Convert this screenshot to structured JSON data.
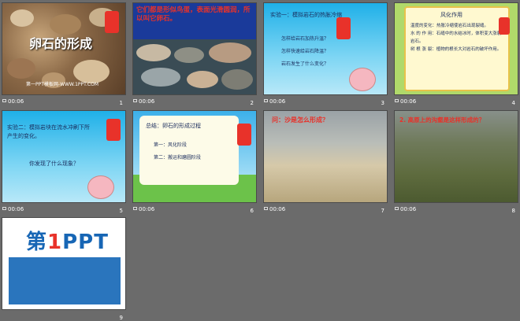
{
  "slides": [
    {
      "num": "1",
      "duration": "00:06",
      "title": "卵石的形成",
      "subtitle": "第一PPT模板网-WWW.1PPT.COM"
    },
    {
      "num": "2",
      "duration": "00:06",
      "caption": "它们都是形似鸟蛋，表面光滑圆润，所以叫它卵石。"
    },
    {
      "num": "3",
      "duration": "00:06",
      "heading": "实验一：模拟岩石的热胀冷缩",
      "items": [
        "怎样给岩石加热升温？",
        "怎样快速给岩石降温？",
        "岩石发生了什么变化？"
      ]
    },
    {
      "num": "4",
      "duration": "00:06",
      "heading": "风化作用",
      "lines": [
        "温度的变化：热胀冷缩使岩石出现裂缝。",
        "水 的 作 用：石缝中的水结冰时，体积变大涨裂岩石。",
        "树 根 涨 裂：植物的根长大对岩石的破坏作用。"
      ]
    },
    {
      "num": "5",
      "duration": "00:06",
      "heading": "实验二：模拟岩块在流水冲刷下所产生的变化。",
      "question": "你发现了什么现象？"
    },
    {
      "num": "6",
      "duration": "00:06",
      "heading": "总结：卵石的形成过程",
      "items": [
        "第一：风化阶段",
        "第二：搬运和磨圆阶段"
      ]
    },
    {
      "num": "7",
      "duration": "00:06",
      "heading": "问：沙是怎么形成？"
    },
    {
      "num": "8",
      "duration": "00:06",
      "heading": "2. 高原上的沟壑是这样形成的？"
    },
    {
      "num": "9",
      "duration": "",
      "logo_a": "第",
      "logo_one": "1",
      "logo_b": "PPT"
    }
  ]
}
